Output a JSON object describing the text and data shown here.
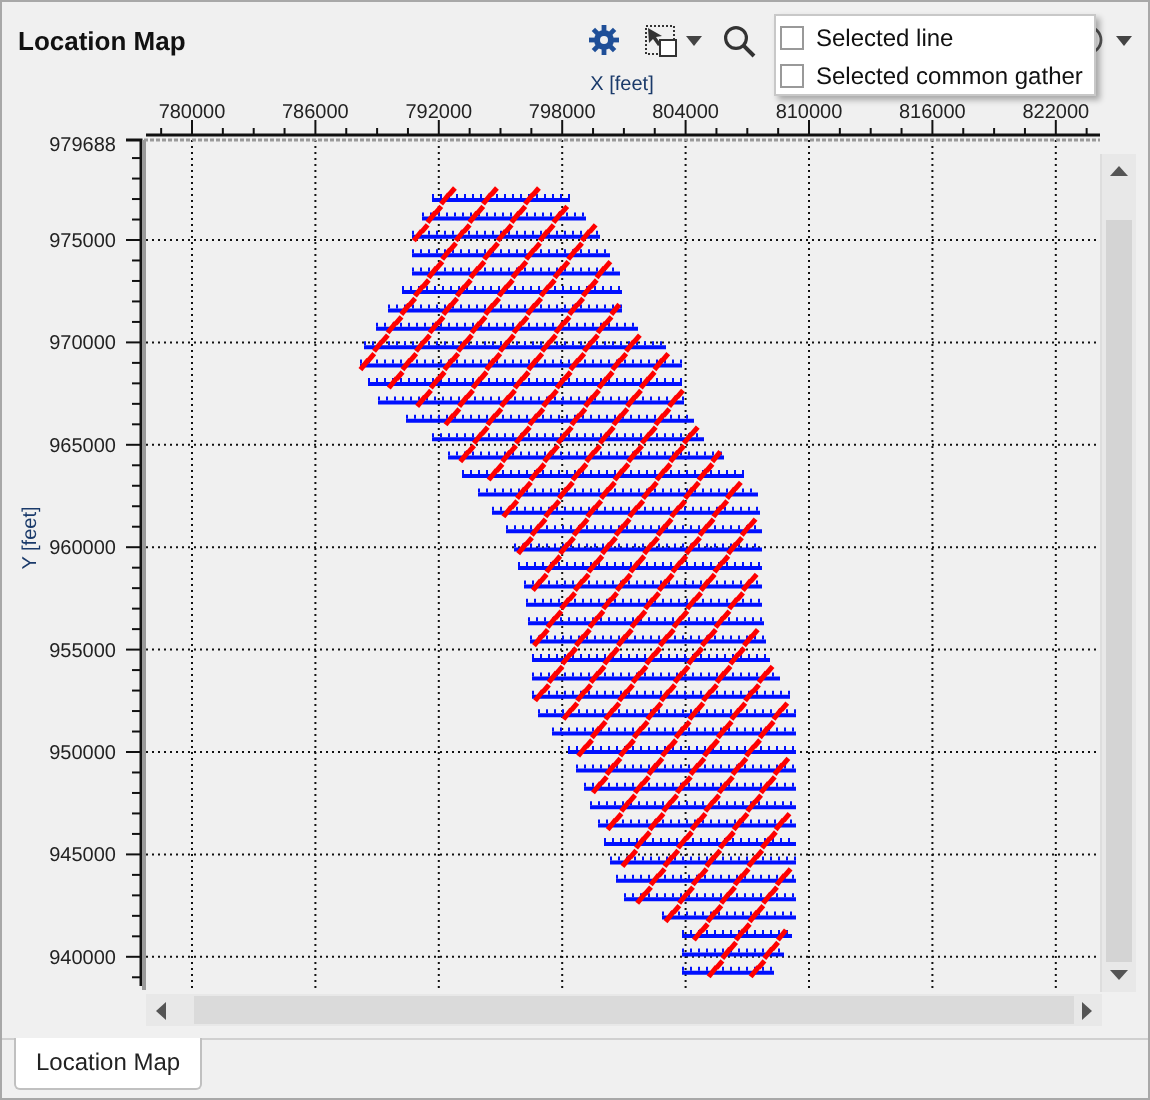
{
  "panel": {
    "title": "Location Map"
  },
  "display_menu": {
    "items": [
      {
        "label": "Selected line",
        "checked": false
      },
      {
        "label": "Selected common gather",
        "checked": false
      }
    ]
  },
  "map": {
    "x_axis": {
      "label": "X [feet]",
      "ticks": [
        "780000",
        "786000",
        "792000",
        "798000",
        "804000",
        "810000",
        "816000",
        "822000"
      ]
    },
    "y_axis": {
      "label": "Y [feet]",
      "ticks": [
        "979688",
        "975000",
        "970000",
        "965000",
        "960000",
        "955000",
        "950000",
        "945000",
        "940000"
      ]
    }
  },
  "tabs": [
    {
      "label": "Location Map",
      "selected": true
    }
  ]
}
